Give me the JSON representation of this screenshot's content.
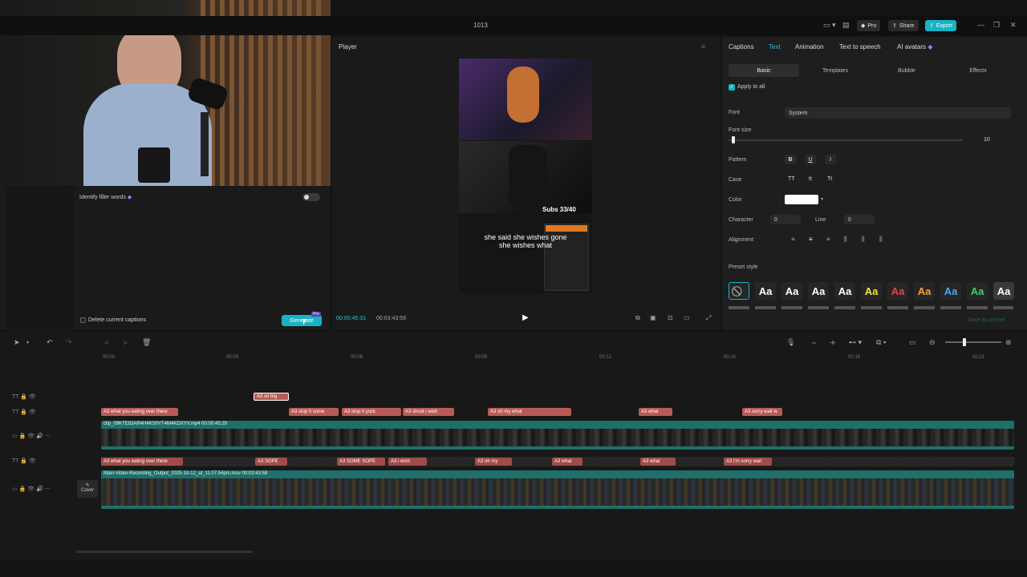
{
  "window": {
    "title": "1013"
  },
  "top_buttons": {
    "pro": "Pro",
    "share": "Share",
    "export": "Export"
  },
  "left_panel": {
    "filler_label": "Identify filler words",
    "delete_label": "Delete current captions",
    "generate_label": "Generate",
    "pro_badge": "Pro"
  },
  "player": {
    "title": "Player",
    "current_time": "00:00:45:31",
    "total_time": "00:03:43:59",
    "caption_line1": "she said she wishes gone",
    "caption_line2": "she wishes what",
    "subs_overlay": "Subs 33/40"
  },
  "right_panel": {
    "tabs": [
      "Captions",
      "Text",
      "Animation",
      "Text to speech",
      "AI avatars"
    ],
    "active_tab": "Text",
    "subtabs": [
      "Basic",
      "Templates",
      "Bubble",
      "Effects"
    ],
    "apply_all": "Apply to all",
    "font_label": "Font",
    "font_value": "System",
    "font_size_label": "Font size",
    "font_size_value": "10",
    "pattern_label": "Pattern",
    "pattern_b": "B",
    "pattern_u": "U",
    "pattern_i": "I",
    "case_label": "Case",
    "case_tt": "TT",
    "case_tt_lower": "tt",
    "case_title": "Tt",
    "color_label": "Color",
    "character_label": "Character",
    "character_value": "0",
    "line_label": "Line",
    "line_value": "0",
    "alignment_label": "Alignment",
    "preset_label": "Preset style",
    "save_preset": "Save as preset",
    "preset_text": "Aa",
    "preset_colors": [
      "#ffffff",
      "#ffffff",
      "#ffffff",
      "#ffffff",
      "#f4e33a",
      "#e0454e",
      "#f2a23a",
      "#4aa8f0",
      "#3ccf6a",
      "#ffffff"
    ]
  },
  "timeline": {
    "ticks": [
      "00:00",
      "00:03",
      "00:06",
      "00:09",
      "00:12",
      "00:15",
      "00:18",
      "00:21"
    ],
    "track1": [
      "so big"
    ],
    "track2": [
      "what you eating over there",
      "stop it some",
      "stop it yuck",
      "shoot i wish",
      "oh my what",
      "what",
      "sorry wait w"
    ],
    "video1_caption": "clip_09KTE83AR4H4KS0YT4M4KDXYV.mp4   00:00:45:29",
    "track4": [
      "what you eating over there",
      "SOPE",
      "SOME SOPE",
      "i wish",
      "oh my",
      "what",
      "what",
      "I'm sorry wait"
    ],
    "video2_caption": "Main-Video-Recording_Output_2025-10-12_at_11.07.54pm.mov   00:03:43:59",
    "cover_label": "Cover",
    "clip_badge": "A3"
  }
}
